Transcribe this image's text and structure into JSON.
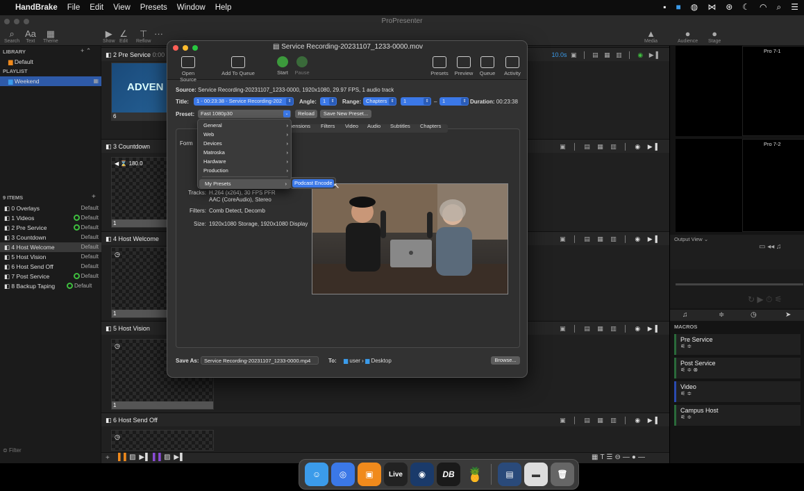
{
  "menubar": {
    "apple": "",
    "app": "HandBrake",
    "items": [
      "File",
      "Edit",
      "View",
      "Presets",
      "Window",
      "Help"
    ]
  },
  "propresenter": {
    "title": "ProPresenter",
    "toolbar": {
      "search": "Search",
      "text": "Text",
      "theme": "Theme",
      "show": "Show",
      "edit": "Edit",
      "reflow": "Reflow",
      "media": "Media",
      "audience": "Audience",
      "stage": "Stage"
    },
    "sidebar": {
      "library_header": "LIBRARY",
      "library_item": "Default",
      "playlist_header": "PLAYLIST",
      "playlist_item": "Weekend",
      "count": "9 ITEMS",
      "items": [
        {
          "label": "0 Overlays",
          "right": "Default"
        },
        {
          "label": "1 Videos",
          "right": "Default"
        },
        {
          "label": "2 Pre Service",
          "right": "Default"
        },
        {
          "label": "3 Countdown",
          "right": "Default"
        },
        {
          "label": "4 Host Welcome",
          "right": "Default"
        },
        {
          "label": "5 Host Vision",
          "right": "Default"
        },
        {
          "label": "6 Host Send Off",
          "right": "Default"
        },
        {
          "label": "7 Post Service",
          "right": "Default"
        },
        {
          "label": "8 Backup Taping",
          "right": "Default"
        }
      ],
      "filter": "Filter"
    },
    "sections": [
      {
        "title": "2 Pre Service",
        "timer": "0:00"
      },
      {
        "title": "3 Countdown"
      },
      {
        "title": "4 Host Welcome"
      },
      {
        "title": "5 Host Vision"
      },
      {
        "title": "6 Host Send Off"
      }
    ],
    "slides": {
      "s1_text": "ADVEN",
      "s1_num": "6",
      "s1_label": "Pr",
      "countdown_text": "180.0",
      "countdown_num": "1",
      "hostwelcome_num": "1",
      "hostvision_num": "1"
    },
    "right_panel": {
      "timer": "10.0s",
      "pro1": "Pro 7-1",
      "pro2": "Pro 7-2",
      "output_view": "Output View",
      "macros_header": "MACROS",
      "macros": [
        "Pre Service",
        "Post Service",
        "Video",
        "Campus Host"
      ]
    }
  },
  "handbrake": {
    "title": "Service Recording-20231107_1233-0000.mov",
    "toolbar": {
      "open_source": "Open Source",
      "add_to_queue": "Add To Queue",
      "start": "Start",
      "pause": "Pause",
      "presets": "Presets",
      "preview": "Preview",
      "queue": "Queue",
      "activity": "Activity"
    },
    "source_label": "Source:",
    "source_value": "Service Recording-20231107_1233-0000, 1920x1080, 29.97 FPS, 1 audio track",
    "title_label": "Title:",
    "title_value": "1 - 00:23:38 - Service Recording-202",
    "angle_label": "Angle:",
    "angle_value": "1",
    "range_label": "Range:",
    "range_type": "Chapters",
    "range_from": "1",
    "range_dash": "–",
    "range_to": "1",
    "duration_label": "Duration:",
    "duration_value": "00:23:38",
    "preset_label": "Preset:",
    "preset_value": "Fast 1080p30",
    "reload": "Reload",
    "save_new_preset": "Save New Preset...",
    "tabs": [
      "Dimensions",
      "Filters",
      "Video",
      "Audio",
      "Subtitles",
      "Chapters"
    ],
    "tab_partial": "nensions",
    "format_label": "Form",
    "tracks_label": "Tracks:",
    "tracks_line1": "H.264 (x264), 30 FPS PFR",
    "tracks_line2": "AAC (CoreAudio), Stereo",
    "filters_label": "Filters:",
    "filters_value": "Comb Detect, Decomb",
    "size_label": "Size:",
    "size_value": "1920x1080 Storage, 1920x1080 Display",
    "save_as_label": "Save As:",
    "save_as_value": "Service Recording-20231107_1233-0000.mp4",
    "to_label": "To:",
    "to_user": "user",
    "to_sep": "›",
    "to_desktop": "Desktop",
    "browse": "Browse...",
    "preset_menu": [
      "General",
      "Web",
      "Devices",
      "Matroska",
      "Hardware",
      "Production",
      "My Presets"
    ],
    "submenu_item": "Podcast Encode"
  },
  "dock": {
    "live_label": "Live",
    "db_label": "DB"
  },
  "colors": {
    "accent": "#3b78e7",
    "green": "#3c9a3c",
    "orange": "#f08a1c",
    "purple": "#8a4bd6"
  }
}
